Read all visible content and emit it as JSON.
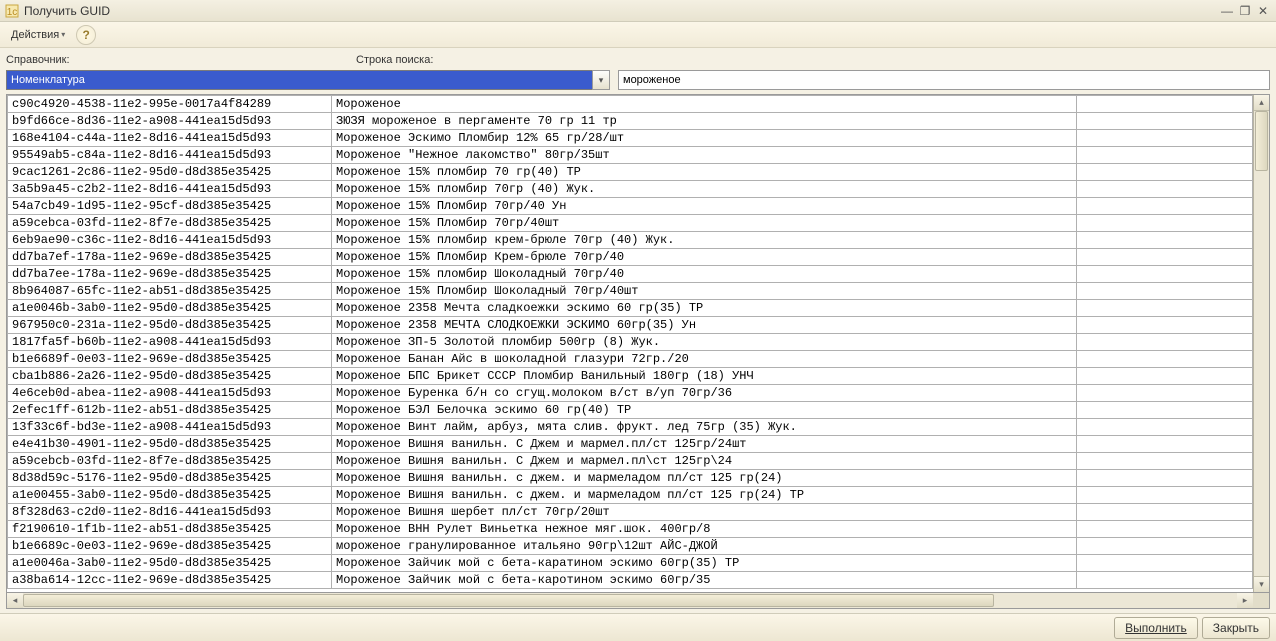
{
  "window": {
    "title": "Получить GUID"
  },
  "toolbar": {
    "actions_label": "Действия"
  },
  "labels": {
    "reference": "Справочник:",
    "search": "Строка поиска:"
  },
  "inputs": {
    "reference_value": "Номенклатура",
    "search_value": "мороженое"
  },
  "footer": {
    "execute": "Выполнить",
    "close": "Закрыть"
  },
  "rows": [
    {
      "guid": "c90c4920-4538-11e2-995e-0017a4f84289",
      "name": "Мороженое"
    },
    {
      "guid": "b9fd66ce-8d36-11e2-a908-441ea15d5d93",
      "name": " ЗЮЗЯ мороженое  в пергаменте 70 гр 11 тр"
    },
    {
      "guid": "168e4104-c44a-11e2-8d16-441ea15d5d93",
      "name": "Мороженое  Эскимо Пломбир 12% 65 гр/28/шт"
    },
    {
      "guid": "95549ab5-c84a-11e2-8d16-441ea15d5d93",
      "name": "Мороженое \"Нежное лакомство\" 80гр/35шт"
    },
    {
      "guid": "9cac1261-2c86-11e2-95d0-d8d385e35425",
      "name": "Мороженое 15% пломбир 70 гр(40) ТР"
    },
    {
      "guid": "3a5b9a45-c2b2-11e2-8d16-441ea15d5d93",
      "name": "Мороженое 15% пломбир 70гр (40) Жук."
    },
    {
      "guid": "54a7cb49-1d95-11e2-95cf-d8d385e35425",
      "name": "Мороженое 15% Пломбир 70гр/40 Ун"
    },
    {
      "guid": "a59cebca-03fd-11e2-8f7e-d8d385e35425",
      "name": "Мороженое 15% Пломбир 70гр/40шт"
    },
    {
      "guid": "6eb9ae90-c36c-11e2-8d16-441ea15d5d93",
      "name": "Мороженое 15% пломбир крем-брюле 70гр (40) Жук."
    },
    {
      "guid": "dd7ba7ef-178a-11e2-969e-d8d385e35425",
      "name": "Мороженое 15% Пломбир Крем-брюле 70гр/40"
    },
    {
      "guid": "dd7ba7ee-178a-11e2-969e-d8d385e35425",
      "name": "Мороженое 15% пломбир Шоколадный 70гр/40"
    },
    {
      "guid": "8b964087-65fc-11e2-ab51-d8d385e35425",
      "name": "Мороженое 15% Пломбир Шоколадный 70гр/40шт"
    },
    {
      "guid": "a1e0046b-3ab0-11e2-95d0-d8d385e35425",
      "name": "Мороженое 2358 Мечта сладкоежки эскимо 60 гр(35) ТР"
    },
    {
      "guid": "967950c0-231a-11e2-95d0-d8d385e35425",
      "name": "Мороженое 2358 МЕЧТА СЛОДКОЕЖКИ ЭСКИМО 60гр(35) Ун"
    },
    {
      "guid": "1817fa5f-b60b-11e2-a908-441ea15d5d93",
      "name": "Мороженое ЗП-5 Золотой пломбир 500гр (8) Жук."
    },
    {
      "guid": "b1e6689f-0e03-11e2-969e-d8d385e35425",
      "name": "Мороженое Банан Айс в шоколадной глазури 72гр./20"
    },
    {
      "guid": "cba1b886-2a26-11e2-95d0-d8d385e35425",
      "name": "Мороженое БПС Брикет СССР Пломбир Ванильный 180гр (18) УНЧ"
    },
    {
      "guid": "4e6ceb0d-abea-11e2-a908-441ea15d5d93",
      "name": "Мороженое Буренка б/н со сгущ.молоком в/ст в/уп 70гр/36"
    },
    {
      "guid": "2efec1ff-612b-11e2-ab51-d8d385e35425",
      "name": "Мороженое БЭЛ Белочка эскимо 60 гр(40) ТР"
    },
    {
      "guid": "13f33c6f-bd3e-11e2-a908-441ea15d5d93",
      "name": "Мороженое Винт лайм, арбуз, мята слив. фрукт. лед 75гр (35) Жук."
    },
    {
      "guid": "e4e41b30-4901-11e2-95d0-d8d385e35425",
      "name": "Мороженое Вишня ванильн. С Джем и мармел.пл/ст 125гр/24шт"
    },
    {
      "guid": "a59cebcb-03fd-11e2-8f7e-d8d385e35425",
      "name": "Мороженое Вишня ванильн. С Джем и мармел.пл\\ст 125гр\\24"
    },
    {
      "guid": "8d38d59c-5176-11e2-95d0-d8d385e35425",
      "name": "Мороженое Вишня ванильн. с джем. и мармеладом пл/ст 125 гр(24)"
    },
    {
      "guid": "a1e00455-3ab0-11e2-95d0-d8d385e35425",
      "name": "Мороженое Вишня ванильн. с джем. и мармеладом пл/ст 125 гр(24) ТР"
    },
    {
      "guid": "8f328d63-c2d0-11e2-8d16-441ea15d5d93",
      "name": "Мороженое Вишня шербет пл/ст 70гр/20шт"
    },
    {
      "guid": "f2190610-1f1b-11e2-ab51-d8d385e35425",
      "name": "Мороженое ВНН Рулет Виньетка нежное мяг.шок. 400гр/8"
    },
    {
      "guid": "b1e6689c-0e03-11e2-969e-d8d385e35425",
      "name": "мороженое гранулированное итальяно 90гр\\12шт АЙС-ДЖОЙ"
    },
    {
      "guid": "a1e0046a-3ab0-11e2-95d0-d8d385e35425",
      "name": "Мороженое Зайчик мой с бета-каратином эскимо 60гр(35) ТР"
    },
    {
      "guid": "a38ba614-12cc-11e2-969e-d8d385e35425",
      "name": "Мороженое Зайчик мой с бета-каротином эскимо 60гр/35"
    }
  ]
}
